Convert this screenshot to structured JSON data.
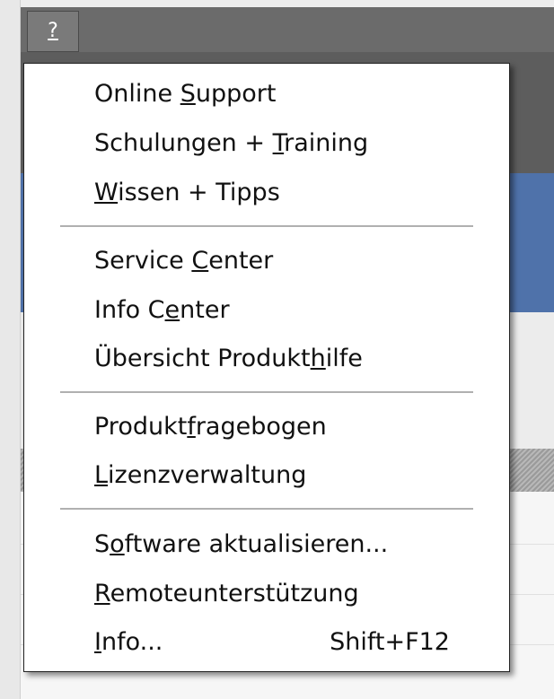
{
  "menu_button": {
    "label": "?"
  },
  "menu": {
    "groups": [
      {
        "items": [
          {
            "label_pre": "Online ",
            "accel": "S",
            "label_post": "upport",
            "shortcut": ""
          },
          {
            "label_pre": "Schulungen + ",
            "accel": "T",
            "label_post": "raining",
            "shortcut": ""
          },
          {
            "label_pre": "",
            "accel": "W",
            "label_post": "issen + Tipps",
            "shortcut": ""
          }
        ]
      },
      {
        "items": [
          {
            "label_pre": "Service ",
            "accel": "C",
            "label_post": "enter",
            "shortcut": ""
          },
          {
            "label_pre": "Info C",
            "accel": "e",
            "label_post": "nter",
            "shortcut": ""
          },
          {
            "label_pre": "Übersicht Produkt",
            "accel": "h",
            "label_post": "ilfe",
            "shortcut": ""
          }
        ]
      },
      {
        "items": [
          {
            "label_pre": "Produkt",
            "accel": "f",
            "label_post": "ragebogen",
            "shortcut": ""
          },
          {
            "label_pre": "",
            "accel": "L",
            "label_post": "izenzverwaltung",
            "shortcut": ""
          }
        ]
      },
      {
        "items": [
          {
            "label_pre": "S",
            "accel": "o",
            "label_post": "ftware aktualisieren...",
            "shortcut": ""
          },
          {
            "label_pre": "",
            "accel": "R",
            "label_post": "emoteunterstützung",
            "shortcut": ""
          },
          {
            "label_pre": "",
            "accel": "I",
            "label_post": "nfo...",
            "shortcut": "Shift+F12"
          }
        ]
      }
    ]
  }
}
